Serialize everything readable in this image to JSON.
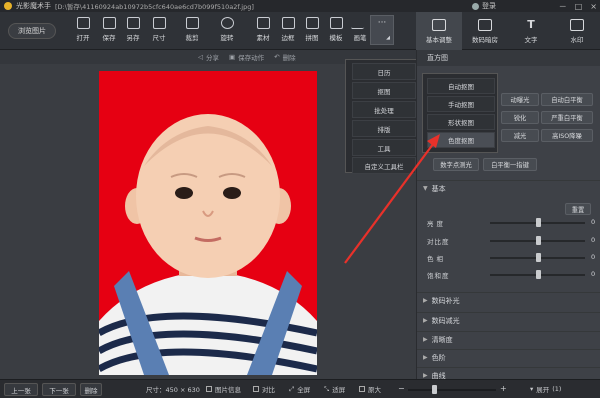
{
  "titlebar": {
    "app_name": "光影魔术手",
    "path": "[D:\\暂存\\41160924ab10972b5cfc640ae6cd7b099f510a2f.jpg]",
    "login": "登录",
    "window_controls": [
      "－",
      "□",
      "×"
    ]
  },
  "toolbar": {
    "browse": "浏览图片",
    "tools": [
      "打开",
      "保存",
      "另存",
      "尺寸",
      "裁剪",
      "旋转",
      "素材",
      "边框",
      "拼图",
      "模板",
      "画笔",
      "···"
    ]
  },
  "right_tabs": [
    "基本调整",
    "数码暗房",
    "文字",
    "水印"
  ],
  "subbar": {
    "share": "分享",
    "save_action": "保存动作",
    "remove": "删除"
  },
  "dropdown_menu": [
    "日历",
    "抠图",
    "批处理",
    "排版",
    "工具",
    "自定义工具栏"
  ],
  "sub_menu": [
    "自动抠图",
    "手动抠图",
    "形状抠图",
    "色度抠图"
  ],
  "right_panel": {
    "header": "直方图",
    "buttons": [
      [
        "",
        "动曝光",
        "自动白平衡"
      ],
      [
        "",
        "锐化",
        "严重白平衡"
      ],
      [
        "",
        "减光",
        "高ISO降噪"
      ],
      [
        "数字点测光",
        "白平衡一指键"
      ]
    ],
    "basic": {
      "title": "基本",
      "reset": "重置",
      "sliders": [
        {
          "name": "亮度",
          "value": "0",
          "level": 0.5
        },
        {
          "name": "对比度",
          "value": "0",
          "level": 0.5
        },
        {
          "name": "色相",
          "value": "0",
          "level": 0.5
        },
        {
          "name": "饱和度",
          "value": "0",
          "level": 0.5
        }
      ]
    },
    "sections": [
      "数码补光",
      "数码减光",
      "清晰度",
      "色阶",
      "曲线"
    ]
  },
  "bottombar": {
    "prev": "上一张",
    "next": "下一张",
    "delete": "删除",
    "size": "尺寸：450 × 630",
    "info": "图片信息",
    "compare": "对比",
    "fullscreen": "全屏",
    "fit": "适屏",
    "original": "原大",
    "zoom_level": 0.3,
    "expand": "展开",
    "expand_count": "(1)"
  }
}
